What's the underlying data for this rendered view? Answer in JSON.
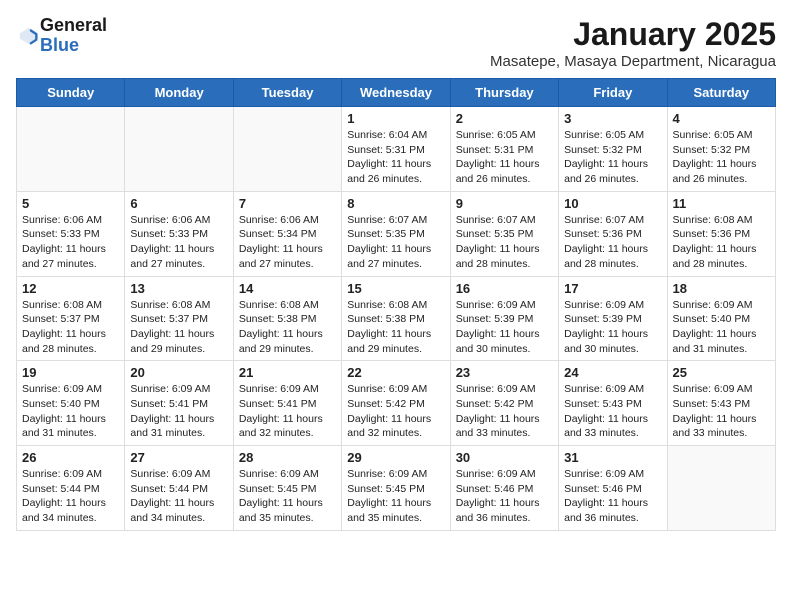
{
  "header": {
    "logo_general": "General",
    "logo_blue": "Blue",
    "month_year": "January 2025",
    "location": "Masatepe, Masaya Department, Nicaragua"
  },
  "days_of_week": [
    "Sunday",
    "Monday",
    "Tuesday",
    "Wednesday",
    "Thursday",
    "Friday",
    "Saturday"
  ],
  "weeks": [
    [
      {
        "day": "",
        "info": ""
      },
      {
        "day": "",
        "info": ""
      },
      {
        "day": "",
        "info": ""
      },
      {
        "day": "1",
        "info": "Sunrise: 6:04 AM\nSunset: 5:31 PM\nDaylight: 11 hours and 26 minutes."
      },
      {
        "day": "2",
        "info": "Sunrise: 6:05 AM\nSunset: 5:31 PM\nDaylight: 11 hours and 26 minutes."
      },
      {
        "day": "3",
        "info": "Sunrise: 6:05 AM\nSunset: 5:32 PM\nDaylight: 11 hours and 26 minutes."
      },
      {
        "day": "4",
        "info": "Sunrise: 6:05 AM\nSunset: 5:32 PM\nDaylight: 11 hours and 26 minutes."
      }
    ],
    [
      {
        "day": "5",
        "info": "Sunrise: 6:06 AM\nSunset: 5:33 PM\nDaylight: 11 hours and 27 minutes."
      },
      {
        "day": "6",
        "info": "Sunrise: 6:06 AM\nSunset: 5:33 PM\nDaylight: 11 hours and 27 minutes."
      },
      {
        "day": "7",
        "info": "Sunrise: 6:06 AM\nSunset: 5:34 PM\nDaylight: 11 hours and 27 minutes."
      },
      {
        "day": "8",
        "info": "Sunrise: 6:07 AM\nSunset: 5:35 PM\nDaylight: 11 hours and 27 minutes."
      },
      {
        "day": "9",
        "info": "Sunrise: 6:07 AM\nSunset: 5:35 PM\nDaylight: 11 hours and 28 minutes."
      },
      {
        "day": "10",
        "info": "Sunrise: 6:07 AM\nSunset: 5:36 PM\nDaylight: 11 hours and 28 minutes."
      },
      {
        "day": "11",
        "info": "Sunrise: 6:08 AM\nSunset: 5:36 PM\nDaylight: 11 hours and 28 minutes."
      }
    ],
    [
      {
        "day": "12",
        "info": "Sunrise: 6:08 AM\nSunset: 5:37 PM\nDaylight: 11 hours and 28 minutes."
      },
      {
        "day": "13",
        "info": "Sunrise: 6:08 AM\nSunset: 5:37 PM\nDaylight: 11 hours and 29 minutes."
      },
      {
        "day": "14",
        "info": "Sunrise: 6:08 AM\nSunset: 5:38 PM\nDaylight: 11 hours and 29 minutes."
      },
      {
        "day": "15",
        "info": "Sunrise: 6:08 AM\nSunset: 5:38 PM\nDaylight: 11 hours and 29 minutes."
      },
      {
        "day": "16",
        "info": "Sunrise: 6:09 AM\nSunset: 5:39 PM\nDaylight: 11 hours and 30 minutes."
      },
      {
        "day": "17",
        "info": "Sunrise: 6:09 AM\nSunset: 5:39 PM\nDaylight: 11 hours and 30 minutes."
      },
      {
        "day": "18",
        "info": "Sunrise: 6:09 AM\nSunset: 5:40 PM\nDaylight: 11 hours and 31 minutes."
      }
    ],
    [
      {
        "day": "19",
        "info": "Sunrise: 6:09 AM\nSunset: 5:40 PM\nDaylight: 11 hours and 31 minutes."
      },
      {
        "day": "20",
        "info": "Sunrise: 6:09 AM\nSunset: 5:41 PM\nDaylight: 11 hours and 31 minutes."
      },
      {
        "day": "21",
        "info": "Sunrise: 6:09 AM\nSunset: 5:41 PM\nDaylight: 11 hours and 32 minutes."
      },
      {
        "day": "22",
        "info": "Sunrise: 6:09 AM\nSunset: 5:42 PM\nDaylight: 11 hours and 32 minutes."
      },
      {
        "day": "23",
        "info": "Sunrise: 6:09 AM\nSunset: 5:42 PM\nDaylight: 11 hours and 33 minutes."
      },
      {
        "day": "24",
        "info": "Sunrise: 6:09 AM\nSunset: 5:43 PM\nDaylight: 11 hours and 33 minutes."
      },
      {
        "day": "25",
        "info": "Sunrise: 6:09 AM\nSunset: 5:43 PM\nDaylight: 11 hours and 33 minutes."
      }
    ],
    [
      {
        "day": "26",
        "info": "Sunrise: 6:09 AM\nSunset: 5:44 PM\nDaylight: 11 hours and 34 minutes."
      },
      {
        "day": "27",
        "info": "Sunrise: 6:09 AM\nSunset: 5:44 PM\nDaylight: 11 hours and 34 minutes."
      },
      {
        "day": "28",
        "info": "Sunrise: 6:09 AM\nSunset: 5:45 PM\nDaylight: 11 hours and 35 minutes."
      },
      {
        "day": "29",
        "info": "Sunrise: 6:09 AM\nSunset: 5:45 PM\nDaylight: 11 hours and 35 minutes."
      },
      {
        "day": "30",
        "info": "Sunrise: 6:09 AM\nSunset: 5:46 PM\nDaylight: 11 hours and 36 minutes."
      },
      {
        "day": "31",
        "info": "Sunrise: 6:09 AM\nSunset: 5:46 PM\nDaylight: 11 hours and 36 minutes."
      },
      {
        "day": "",
        "info": ""
      }
    ]
  ]
}
